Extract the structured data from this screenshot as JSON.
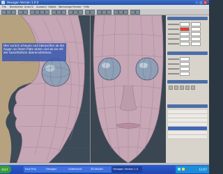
{
  "window": {
    "title": "Hexagon Version 1.0.0"
  },
  "menu": {
    "items": [
      "File",
      "Bearbeiten",
      "Ansicht",
      "Auswahl",
      "Objekt",
      "Werkzeuge",
      "Fenster",
      "Hilfe"
    ]
  },
  "viewport": {
    "note_text": "Hier zurück schauen und überprüfen ob die Augen an ihrem Platz sitzen und ob sie mit der Gesichtsform übereinstimmen."
  },
  "taskbar": {
    "start_label": "start",
    "tasks": [
      "Face Proj",
      "Hexagon",
      "Unbenannt",
      "3D-Modell",
      "Hexagon Version 1.0"
    ],
    "clock": "12:07"
  },
  "colors": {
    "accent": "#3a58b0",
    "skin": "#c7a6b6",
    "highlight_field": "#e23c2e",
    "taskbar": "#2451a8"
  }
}
